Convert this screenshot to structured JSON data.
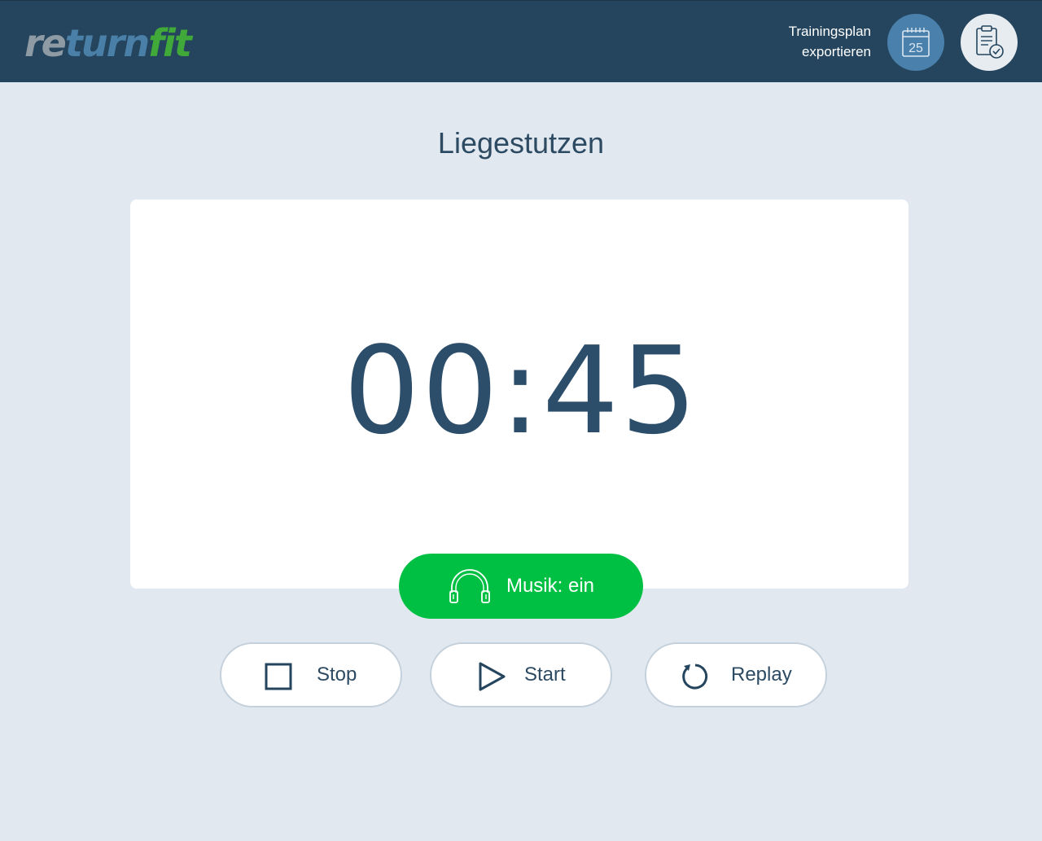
{
  "header": {
    "logo": {
      "part1": "re",
      "part2": "turn",
      "part3": "fit"
    },
    "export_label_line1": "Trainingsplan",
    "export_label_line2": "exportieren",
    "calendar_day": "25",
    "calendar_icon": "calendar-icon",
    "clipboard_icon": "clipboard-check-icon"
  },
  "exercise": {
    "title": "Liegestutzen",
    "timer": "00:45"
  },
  "music": {
    "label": "Musik: ein",
    "icon": "headphones-icon"
  },
  "controls": {
    "stop_label": "Stop",
    "start_label": "Start",
    "replay_label": "Replay"
  },
  "colors": {
    "header_bg": "#24455d",
    "page_bg": "#e1e8ef",
    "accent_green": "#00c043",
    "calendar_btn": "#4a80ac",
    "text_dark": "#2d4a63"
  }
}
